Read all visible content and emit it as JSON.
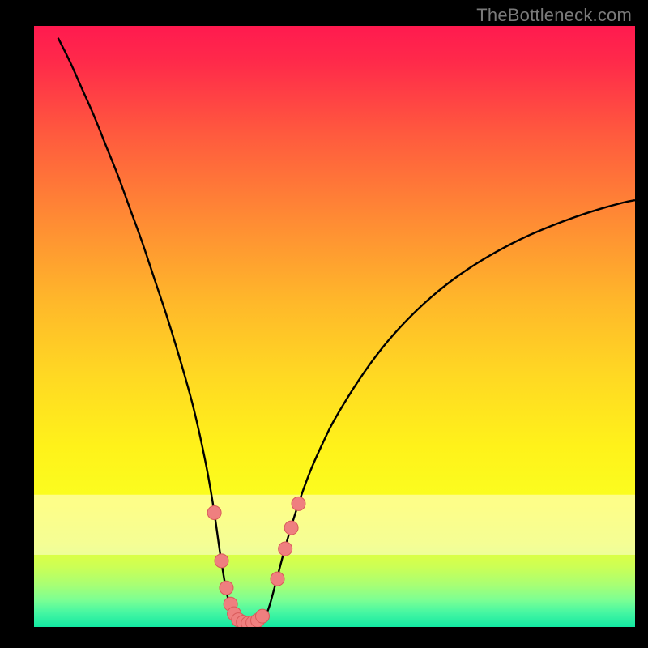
{
  "watermark": "TheBottleneck.com",
  "colors": {
    "frame": "#000000",
    "gradient_stops": [
      {
        "pos": 0.0,
        "color": "#ff1a4f"
      },
      {
        "pos": 0.06,
        "color": "#ff2a4a"
      },
      {
        "pos": 0.18,
        "color": "#ff5a3e"
      },
      {
        "pos": 0.32,
        "color": "#ff8a34"
      },
      {
        "pos": 0.46,
        "color": "#ffb82a"
      },
      {
        "pos": 0.58,
        "color": "#ffd823"
      },
      {
        "pos": 0.7,
        "color": "#fff21a"
      },
      {
        "pos": 0.8,
        "color": "#faff20"
      },
      {
        "pos": 0.86,
        "color": "#e8ff38"
      },
      {
        "pos": 0.9,
        "color": "#ccff55"
      },
      {
        "pos": 0.93,
        "color": "#a8ff74"
      },
      {
        "pos": 0.955,
        "color": "#7cff93"
      },
      {
        "pos": 0.975,
        "color": "#48f7a2"
      },
      {
        "pos": 1.0,
        "color": "#12e8a2"
      }
    ],
    "pale_band": "#fffde0",
    "curve": "#000000",
    "marker_fill": "#ef7f7f",
    "marker_stroke": "#d85a5a"
  },
  "chart_data": {
    "type": "line",
    "title": "",
    "xlabel": "",
    "ylabel": "",
    "xlim": [
      0,
      100
    ],
    "ylim": [
      0,
      100
    ],
    "series": [
      {
        "name": "bottleneck-curve",
        "x": [
          4,
          6,
          8,
          10,
          12,
          14,
          16,
          18,
          20,
          22,
          24,
          26,
          27,
          28,
          29,
          30,
          31,
          32,
          33,
          34,
          35,
          36,
          37,
          38,
          39,
          40,
          42,
          44,
          46,
          48,
          50,
          54,
          58,
          62,
          66,
          70,
          74,
          78,
          82,
          86,
          90,
          94,
          98,
          100
        ],
        "y": [
          98,
          94,
          89.5,
          85,
          80,
          75,
          69.5,
          64,
          58,
          52,
          45.5,
          38.5,
          34.5,
          30,
          25,
          19,
          12,
          6,
          2.2,
          0.8,
          0.4,
          0.4,
          0.6,
          1.2,
          3,
          6.5,
          14,
          20.5,
          26,
          30.5,
          34.5,
          41,
          46.5,
          51,
          54.8,
          58,
          60.7,
          63,
          65,
          66.7,
          68.2,
          69.5,
          70.6,
          71
        ]
      }
    ],
    "markers": {
      "name": "highlighted-points",
      "points": [
        {
          "x": 30.0,
          "y": 19.0
        },
        {
          "x": 31.2,
          "y": 11.0
        },
        {
          "x": 32.0,
          "y": 6.5
        },
        {
          "x": 32.7,
          "y": 3.8
        },
        {
          "x": 33.3,
          "y": 2.2
        },
        {
          "x": 34.0,
          "y": 1.2
        },
        {
          "x": 34.8,
          "y": 0.8
        },
        {
          "x": 35.6,
          "y": 0.6
        },
        {
          "x": 36.4,
          "y": 0.7
        },
        {
          "x": 37.2,
          "y": 1.1
        },
        {
          "x": 38.0,
          "y": 1.8
        },
        {
          "x": 40.5,
          "y": 8.0
        },
        {
          "x": 41.8,
          "y": 13.0
        },
        {
          "x": 42.8,
          "y": 16.5
        },
        {
          "x": 44.0,
          "y": 20.5
        }
      ]
    }
  }
}
